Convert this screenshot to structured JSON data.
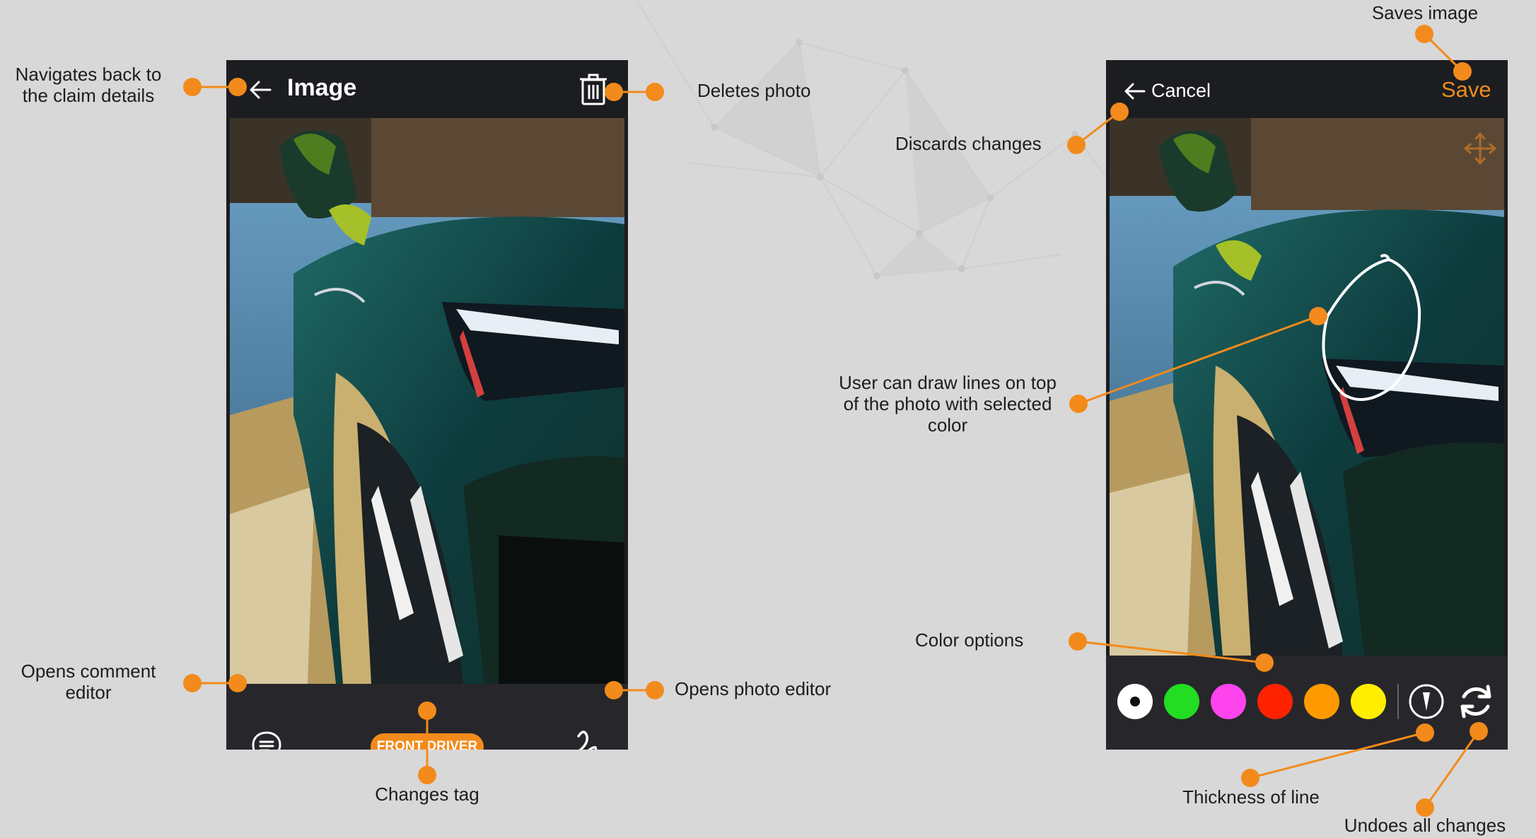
{
  "colors": {
    "accent": "#f28b1b",
    "background": "#d8d8d8",
    "appbar": "#1b1d21",
    "swatches": [
      "#ffffff",
      "#22dd22",
      "#ff44ee",
      "#ff2200",
      "#ff9900",
      "#ffee00"
    ]
  },
  "left_screen": {
    "title": "Image",
    "back_icon": "arrow-left-icon",
    "delete_icon": "trash-icon",
    "comment_icon": "comment-icon",
    "tag": "FRONT DRIVER",
    "editor_icon": "draw-icon"
  },
  "right_screen": {
    "cancel_label": "Cancel",
    "save_label": "Save",
    "move_icon": "move-icon",
    "thickness_icon": "line-thickness-icon",
    "undo_icon": "undo-icon"
  },
  "annotations": {
    "back": [
      "Navigates back to",
      "the claim details"
    ],
    "delete": "Deletes photo",
    "comment": [
      "Opens comment",
      "editor"
    ],
    "editor": "Opens photo editor",
    "tag": "Changes tag",
    "save": "Saves image",
    "discard": "Discards changes",
    "draw": [
      "User can draw lines on top",
      "of the photo with selected",
      "color"
    ],
    "colors": "Color options",
    "thickness": "Thickness of line",
    "undo": "Undoes all changes"
  }
}
